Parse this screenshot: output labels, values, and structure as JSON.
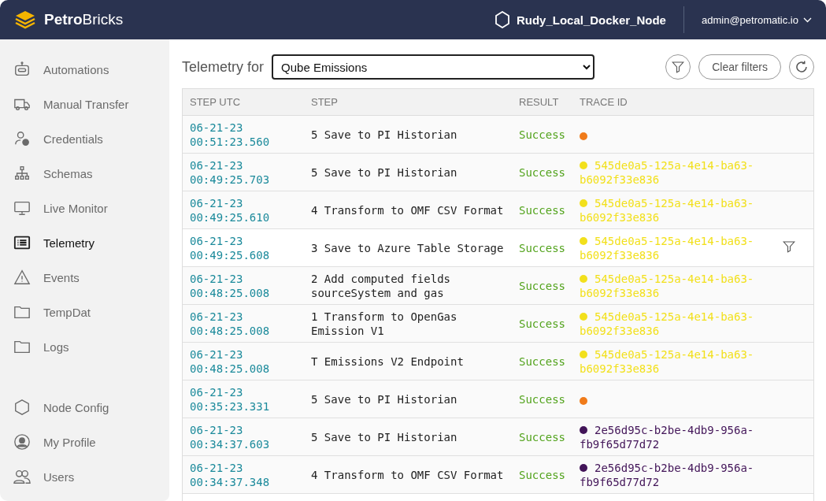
{
  "header": {
    "brand_bold": "Petro",
    "brand_light": "Bricks",
    "node": "Rudy_Local_Docker_Node",
    "user": "admin@petromatic.io"
  },
  "sidebar": {
    "items": [
      {
        "label": "Automations",
        "selected": false
      },
      {
        "label": "Manual Transfer",
        "selected": false
      },
      {
        "label": "Credentials",
        "selected": false
      },
      {
        "label": "Schemas",
        "selected": false
      },
      {
        "label": "Live Monitor",
        "selected": false
      },
      {
        "label": "Telemetry",
        "selected": true
      },
      {
        "label": "Events",
        "selected": false
      },
      {
        "label": "TempDat",
        "selected": false
      },
      {
        "label": "Logs",
        "selected": false
      }
    ],
    "bottom_items": [
      {
        "label": "Node Config",
        "selected": false
      },
      {
        "label": "My Profile",
        "selected": false
      },
      {
        "label": "Users",
        "selected": false
      }
    ]
  },
  "toolbar": {
    "title": "Telemetry for",
    "select_value": "Qube Emissions",
    "clear_label": "Clear filters"
  },
  "table": {
    "columns": [
      "STEP UTC",
      "STEP",
      "RESULT",
      "TRACE ID"
    ],
    "rows": [
      {
        "date": "06-21-23",
        "time": "00:51:23.560",
        "step": "5 Save to PI Historian",
        "result": "Success",
        "color": "#f07b1a",
        "trace": [],
        "hovered": false
      },
      {
        "date": "06-21-23",
        "time": "00:49:25.703",
        "step": "5 Save to PI Historian",
        "result": "Success",
        "color": "#f2e01c",
        "trace": [
          "545de0a5-125a-4e14-ba63-",
          "b6092f33e836"
        ],
        "hovered": false
      },
      {
        "date": "06-21-23",
        "time": "00:49:25.610",
        "step": "4 Transform to OMF CSV Format",
        "result": "Success",
        "color": "#f2e01c",
        "trace": [
          "545de0a5-125a-4e14-ba63-",
          "b6092f33e836"
        ],
        "hovered": false
      },
      {
        "date": "06-21-23",
        "time": "00:49:25.608",
        "step": "3 Save to Azure Table Storage",
        "result": "Success",
        "color": "#f2e01c",
        "trace": [
          "545de0a5-125a-4e14-ba63-",
          "b6092f33e836"
        ],
        "hovered": true
      },
      {
        "date": "06-21-23",
        "time": "00:48:25.008",
        "step": "2 Add computed fields sourceSystem and gas",
        "result": "Success",
        "color": "#f2e01c",
        "trace": [
          "545de0a5-125a-4e14-ba63-",
          "b6092f33e836"
        ],
        "hovered": false
      },
      {
        "date": "06-21-23",
        "time": "00:48:25.008",
        "step": "1 Transform to OpenGas Emission V1",
        "result": "Success",
        "color": "#f2e01c",
        "trace": [
          "545de0a5-125a-4e14-ba63-",
          "b6092f33e836"
        ],
        "hovered": false
      },
      {
        "date": "06-21-23",
        "time": "00:48:25.008",
        "step": "T Emissions V2 Endpoint",
        "result": "Success",
        "color": "#f2e01c",
        "trace": [
          "545de0a5-125a-4e14-ba63-",
          "b6092f33e836"
        ],
        "hovered": false
      },
      {
        "date": "06-21-23",
        "time": "00:35:23.331",
        "step": "5 Save to PI Historian",
        "result": "Success",
        "color": "#f07b1a",
        "trace": [],
        "hovered": false
      },
      {
        "date": "06-21-23",
        "time": "00:34:37.603",
        "step": "5 Save to PI Historian",
        "result": "Success",
        "color": "#421458",
        "trace": [
          "2e56d95c-b2be-4db9-956a-",
          "fb9f65d77d72"
        ],
        "hovered": false
      },
      {
        "date": "06-21-23",
        "time": "00:34:37.348",
        "step": "4 Transform to OMF CSV Format",
        "result": "Success",
        "color": "#421458",
        "trace": [
          "2e56d95c-b2be-4db9-956a-",
          "fb9f65d77d72"
        ],
        "hovered": false
      }
    ]
  }
}
